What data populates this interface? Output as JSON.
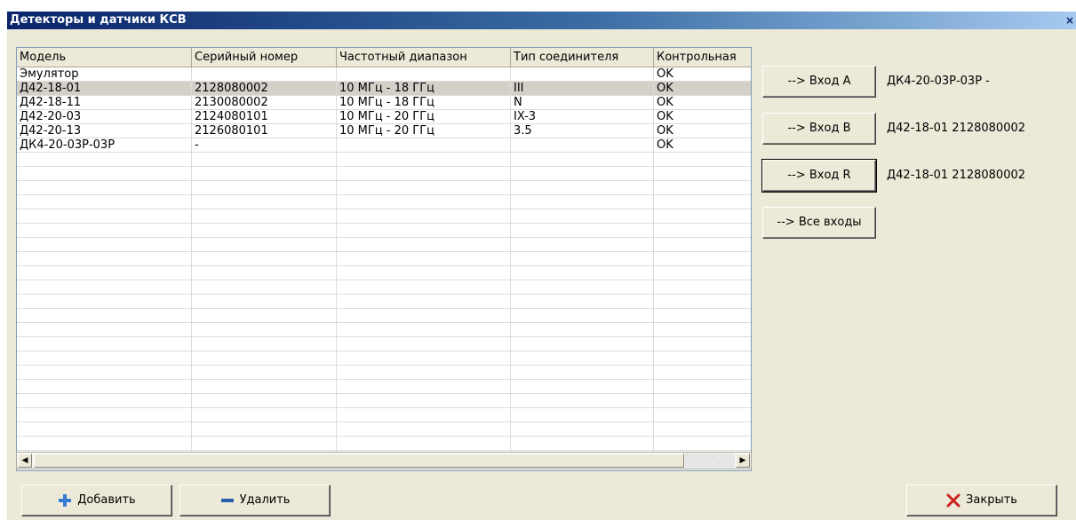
{
  "window": {
    "title": "Детекторы и датчики КСВ",
    "close_glyph": "×"
  },
  "grid": {
    "columns": [
      "Модель",
      "Серийный номер",
      "Частотный диапазон",
      "Тип соединителя",
      "Контрольная"
    ],
    "rows": [
      [
        "Эмулятор",
        "",
        "",
        "",
        "OK"
      ],
      [
        "Д42-18-01",
        "2128080002",
        "10 МГц - 18 ГГц",
        "III",
        "OK"
      ],
      [
        "Д42-18-11",
        "2130080002",
        "10 МГц - 18 ГГц",
        "N",
        "OK"
      ],
      [
        "Д42-20-03",
        "2124080101",
        "10 МГц - 20 ГГц",
        "IX-3",
        "OK"
      ],
      [
        "Д42-20-13",
        "2126080101",
        "10 МГц - 20 ГГц",
        "3.5",
        "OK"
      ],
      [
        "ДК4-20-03Р-03Р",
        "-",
        "",
        "",
        "OK"
      ]
    ],
    "selected_row": 1
  },
  "inputs": {
    "a": {
      "button": "--> Вход A",
      "value": "ДК4-20-03Р-03Р -"
    },
    "b": {
      "button": "--> Вход B",
      "value": "Д42-18-01 2128080002"
    },
    "r": {
      "button": "--> Вход R",
      "value": "Д42-18-01 2128080002"
    },
    "all": {
      "button": "--> Все входы"
    }
  },
  "footer": {
    "add_label": "Добавить",
    "remove_label": "Удалить",
    "close_label": "Закрыть"
  },
  "icons": {
    "plus": "plus-icon",
    "minus": "minus-icon",
    "close": "red-x-icon",
    "scroll_left": "arrow-left-icon",
    "scroll_right": "arrow-right-icon"
  },
  "colors": {
    "titlebar_start": "#0a246a",
    "titlebar_end": "#a6caf0",
    "plus": "#3a7bd5",
    "minus": "#2b5fae",
    "close_x": "#cc2222"
  }
}
